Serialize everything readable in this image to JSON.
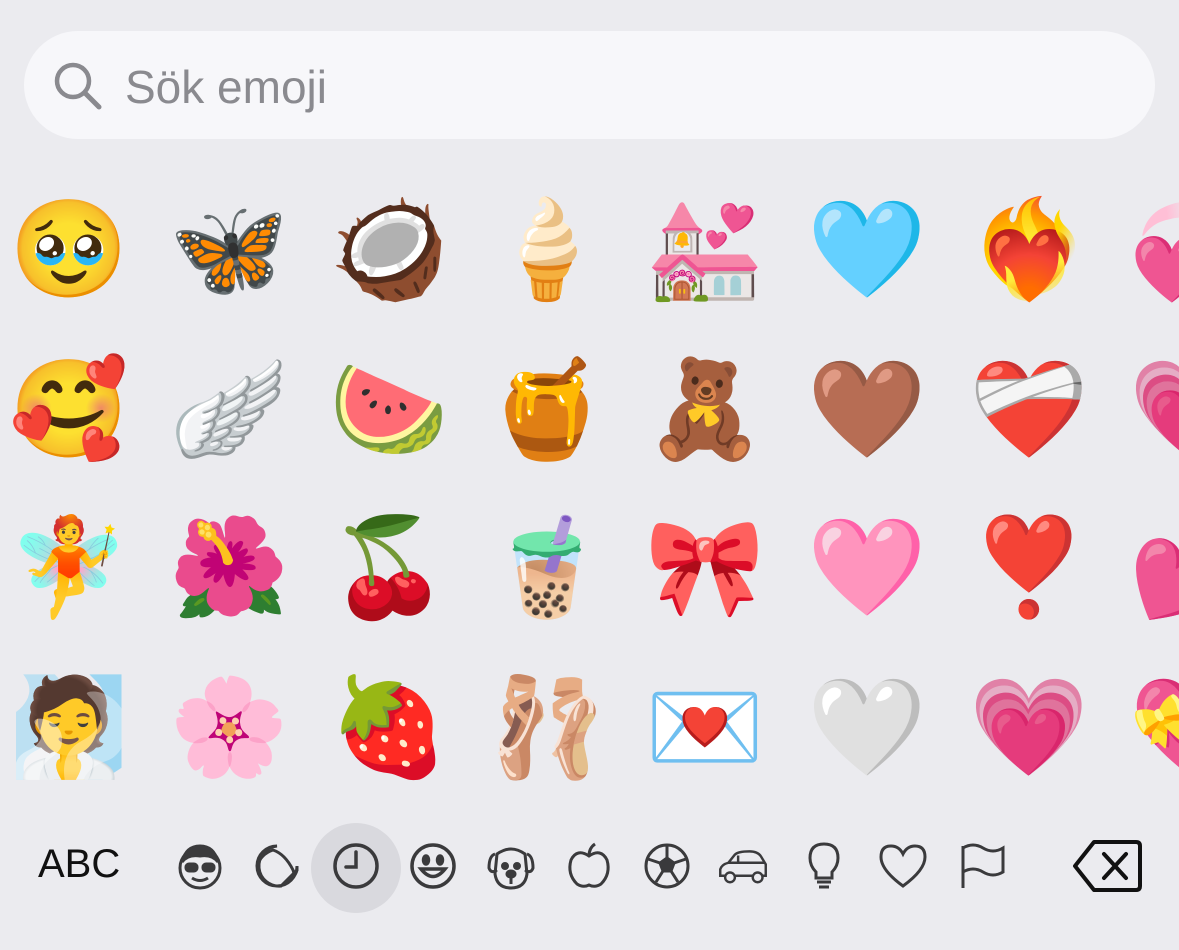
{
  "search": {
    "placeholder": "Sök emoji",
    "icon": "search-icon"
  },
  "emoji_rows": [
    [
      "🥹",
      "🦋",
      "🥥",
      "🍦",
      "💒",
      "🩵",
      "❤️‍🔥",
      "💞"
    ],
    [
      "🥰",
      "🪽",
      "🍉",
      "🍯",
      "🧸",
      "🤎",
      "❤️‍🩹",
      "💗"
    ],
    [
      "🧚",
      "🌺",
      "🍒",
      "🧋",
      "🎀",
      "🩷",
      "❣️",
      "💕"
    ],
    [
      "🧖",
      "🌸",
      "🍓",
      "🩰",
      "💌",
      "🤍",
      "💗",
      "💝"
    ]
  ],
  "keyboard": {
    "abc_label": "ABC",
    "categories": [
      {
        "name": "memoji-stickers",
        "selected": false
      },
      {
        "name": "stickers",
        "selected": false
      },
      {
        "name": "recent",
        "selected": true
      },
      {
        "name": "smileys",
        "selected": false
      },
      {
        "name": "animals",
        "selected": false
      },
      {
        "name": "food",
        "selected": false
      },
      {
        "name": "activity",
        "selected": false
      },
      {
        "name": "travel",
        "selected": false
      },
      {
        "name": "objects",
        "selected": false
      },
      {
        "name": "symbols",
        "selected": false
      },
      {
        "name": "flags",
        "selected": false
      }
    ],
    "delete_icon": "delete-backspace-icon"
  },
  "colors": {
    "background": "#ebebef",
    "search_bg": "#f7f7fa",
    "icon_stroke": "#3a3a3c",
    "placeholder": "#8a8a8f",
    "selected_bg": "#d9d9de"
  }
}
